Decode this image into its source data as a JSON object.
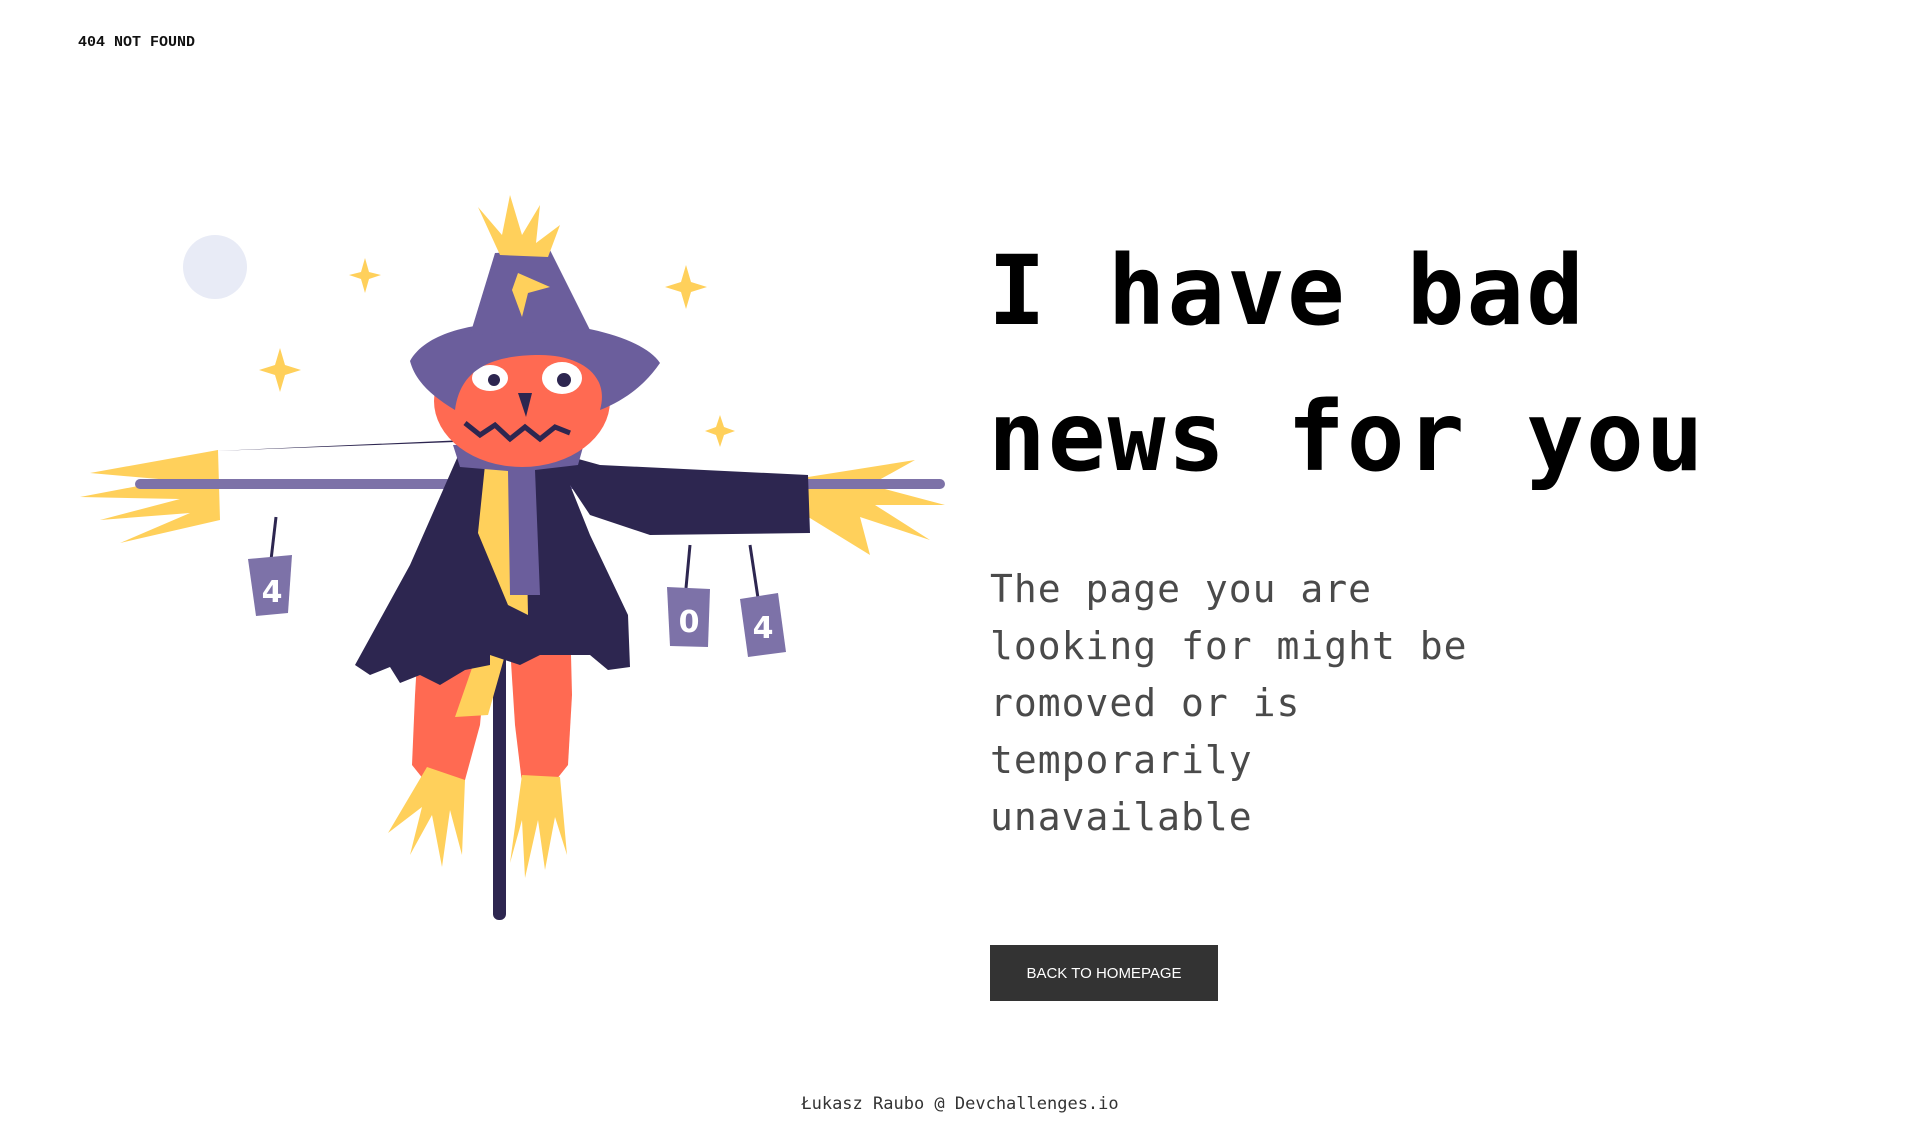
{
  "header": {
    "brand": "404 NOT FOUND"
  },
  "hero": {
    "headline_lines": [
      "I have bad",
      "news for you"
    ],
    "message_lines": [
      "The page you are",
      "looking for might be",
      "romoved or is",
      "temporarily",
      "unavailable"
    ],
    "button_label": "BACK TO HOMEPAGE"
  },
  "illustration": {
    "can_labels": [
      "4",
      "0",
      "4"
    ]
  },
  "footer": {
    "credit": "Łukasz Raubo @ Devchallenges.io"
  },
  "colors": {
    "background": "#ffffff",
    "text": "#000000",
    "body_text": "#4a4a4a",
    "button_bg": "#333333",
    "button_text": "#ffffff",
    "coat": "#2d2650",
    "hat": "#6b5e9c",
    "face": "#ff6a52",
    "straw": "#ffd05b",
    "moon": "#e8ebf6"
  }
}
